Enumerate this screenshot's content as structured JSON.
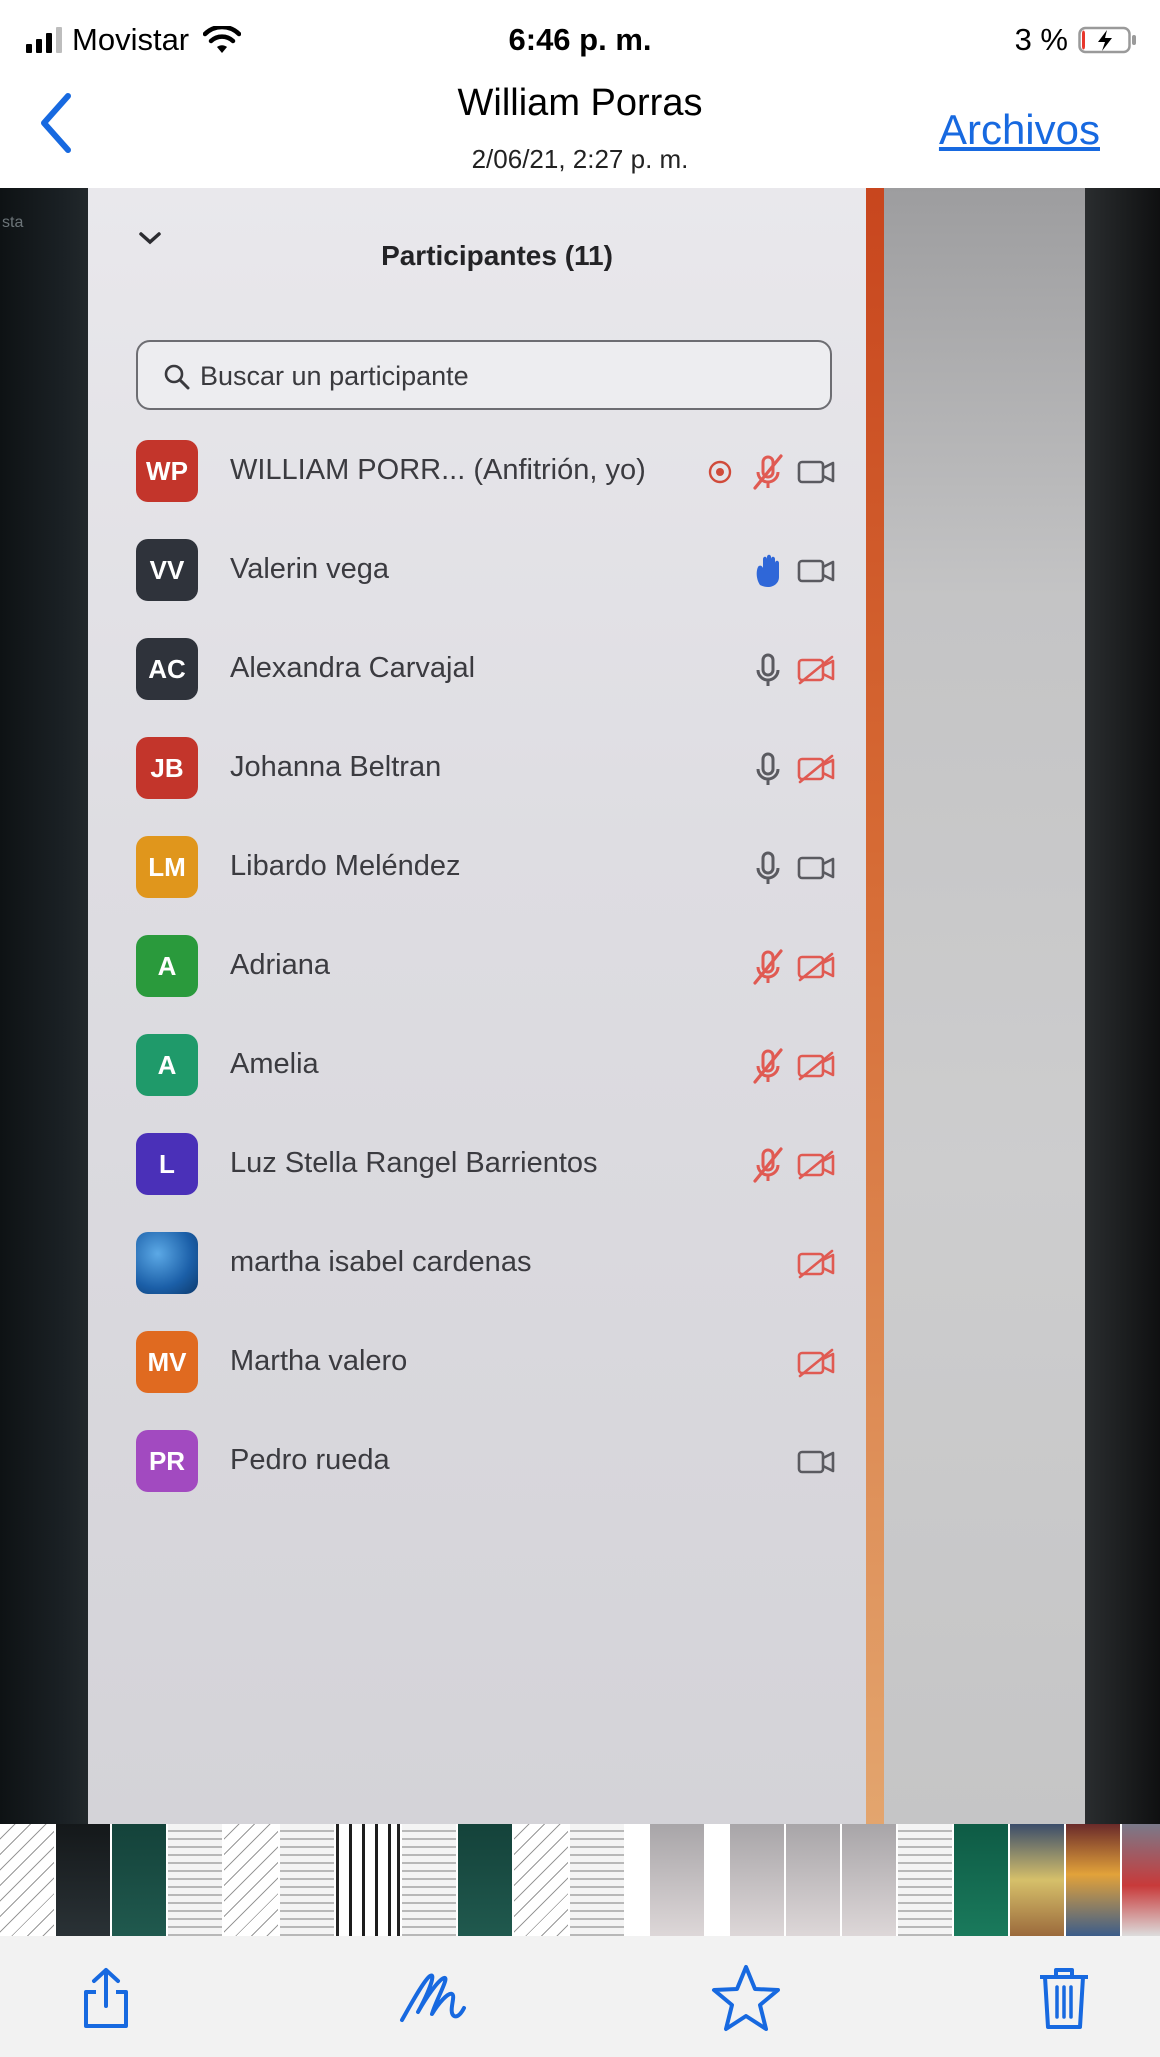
{
  "status_bar": {
    "carrier": "Movistar",
    "time": "6:46 p. m.",
    "battery_percent": "3 %",
    "battery_level": 0.03
  },
  "nav": {
    "title": "William Porras",
    "subtitle": "2/06/21, 2:27 p. m.",
    "files_label": "Archivos"
  },
  "photo": {
    "edge_text": "sta",
    "panel_title": "Participantes (11)",
    "search_placeholder": "Buscar un participante",
    "participants": [
      {
        "initials": "WP",
        "name": "WILLIAM PORR... (Anfitrión, yo)",
        "color": "#c3352b",
        "record_icon": true,
        "mic": "muted",
        "video": "on"
      },
      {
        "initials": "VV",
        "name": "Valerin vega",
        "color": "#2f333b",
        "mic": "raised-hand",
        "video": "on"
      },
      {
        "initials": "AC",
        "name": "Alexandra Carvajal",
        "color": "#2f333b",
        "mic": "on",
        "video": "off"
      },
      {
        "initials": "JB",
        "name": "Johanna Beltran",
        "color": "#c3352b",
        "mic": "on",
        "video": "off"
      },
      {
        "initials": "LM",
        "name": "Libardo Meléndez",
        "color": "#e0961c",
        "mic": "on",
        "video": "on"
      },
      {
        "initials": "A",
        "name": "Adriana",
        "color": "#2a9a3c",
        "mic": "muted",
        "video": "off"
      },
      {
        "initials": "A",
        "name": "Amelia",
        "color": "#1f9a6a",
        "mic": "muted",
        "video": "off"
      },
      {
        "initials": "L",
        "name": "Luz Stella Rangel Barrientos",
        "color": "#4a30b8",
        "mic": "muted",
        "video": "off"
      },
      {
        "initials": "",
        "name": "martha isabel cardenas",
        "color": "#1b5fa8",
        "photo": true,
        "mic": "none",
        "video": "off"
      },
      {
        "initials": "MV",
        "name": "Martha valero",
        "color": "#e06a20",
        "mic": "none",
        "video": "off"
      },
      {
        "initials": "PR",
        "name": "Pedro rueda",
        "color": "#a24ac0",
        "mic": "none",
        "video": "on"
      }
    ]
  },
  "thumbnails": [
    "sketch",
    "dark",
    "teal",
    "doc",
    "sketch",
    "doc",
    "selected",
    "doc",
    "teal",
    "sketch",
    "doc",
    "gap",
    "paper",
    "gap",
    "paper",
    "paper",
    "paper",
    "doc",
    "green",
    "photo1",
    "photo2",
    "photo3",
    "photo1"
  ],
  "toolbar": {
    "share_icon": "share-icon",
    "markup_icon": "markup-icon",
    "favorite_icon": "star-icon",
    "delete_icon": "trash-icon",
    "accent_color": "#1769e0"
  }
}
